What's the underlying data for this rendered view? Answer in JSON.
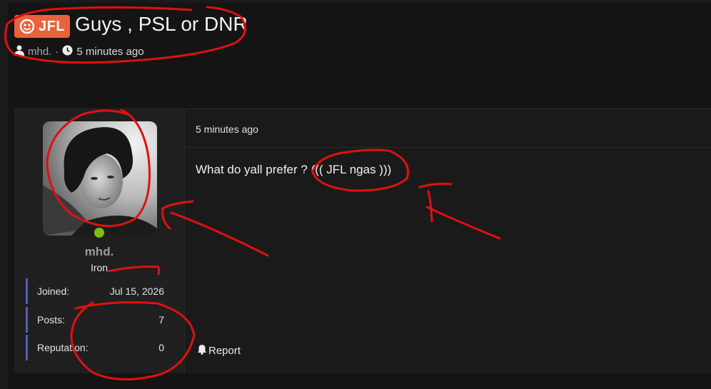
{
  "thread": {
    "prefix": "JFL",
    "title": "Guys , PSL or DNR",
    "author": "mhd.",
    "separator": "·",
    "time": "5 minutes ago"
  },
  "post": {
    "time": "5 minutes ago",
    "message": "What do yall prefer ? ((( JFL ngas )))",
    "report_label": "Report"
  },
  "user": {
    "name": "mhd.",
    "rank": "Iron",
    "online_color": "#7dbb19",
    "stats": [
      {
        "label": "Joined:",
        "value": "Jul 15, 2026"
      },
      {
        "label": "Posts:",
        "value": "7"
      },
      {
        "label": "Reputation:",
        "value": "0"
      }
    ]
  },
  "colors": {
    "prefix_bg": "#e8623b",
    "stat_accent": "#4f5fb6",
    "annotation": "#e01010"
  },
  "icons": {
    "prefix": "smiley-icon",
    "author": "user-icon",
    "time": "clock-icon",
    "report": "bell-icon"
  }
}
